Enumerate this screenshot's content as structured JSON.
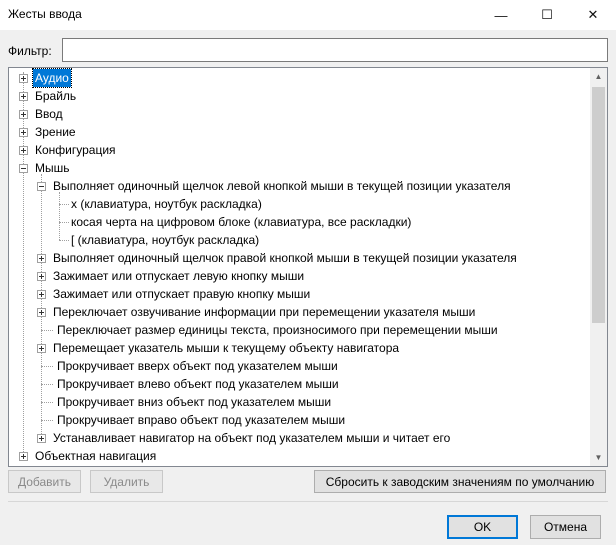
{
  "window": {
    "title": "Жесты ввода",
    "minimize_glyph": "—",
    "maximize_glyph": "☐",
    "close_glyph": "✕"
  },
  "filter": {
    "label": "Фильтр:",
    "value": "",
    "placeholder": ""
  },
  "tree": {
    "items": [
      {
        "label": "Аудио",
        "expanded": false,
        "selected": true
      },
      {
        "label": "Брайль",
        "expanded": false
      },
      {
        "label": "Ввод",
        "expanded": false
      },
      {
        "label": "Зрение",
        "expanded": false
      },
      {
        "label": "Конфигурация",
        "expanded": false
      },
      {
        "label": "Мышь",
        "expanded": true
      },
      {
        "label": "Выполняет одиночный щелчок левой кнопкой мыши в текущей позиции указателя",
        "expanded": true
      },
      {
        "label": "x (клавиатура, ноутбук раскладка)"
      },
      {
        "label": "косая черта на цифровом блоке (клавиатура, все раскладки)"
      },
      {
        "label": "[ (клавиатура, ноутбук раскладка)"
      },
      {
        "label": "Выполняет одиночный щелчок правой кнопкой мыши в текущей позиции указателя",
        "expanded": false
      },
      {
        "label": "Зажимает или отпускает левую кнопку мыши",
        "expanded": false
      },
      {
        "label": "Зажимает или отпускает правую кнопку мыши",
        "expanded": false
      },
      {
        "label": "Переключает озвучивание информации при перемещении указателя мыши",
        "expanded": false
      },
      {
        "label": "Переключает размер единицы текста, произносимого при перемещении мыши"
      },
      {
        "label": "Перемещает указатель мыши к текущему объекту навигатора",
        "expanded": false
      },
      {
        "label": "Прокручивает вверх объект под указателем мыши"
      },
      {
        "label": "Прокручивает влево объект под указателем мыши"
      },
      {
        "label": "Прокручивает вниз объект под указателем мыши"
      },
      {
        "label": "Прокручивает вправо объект под указателем мыши"
      },
      {
        "label": "Устанавливает навигатор на объект под указателем мыши и читает его",
        "expanded": false
      },
      {
        "label": "Объектная навигация",
        "expanded": false
      }
    ],
    "scroll_up_glyph": "▲",
    "scroll_down_glyph": "▼"
  },
  "actions": {
    "add": "Добавить",
    "remove": "Удалить",
    "reset": "Сбросить к заводским значениям по умолчанию"
  },
  "dialog": {
    "ok": "OK",
    "cancel": "Отмена"
  }
}
